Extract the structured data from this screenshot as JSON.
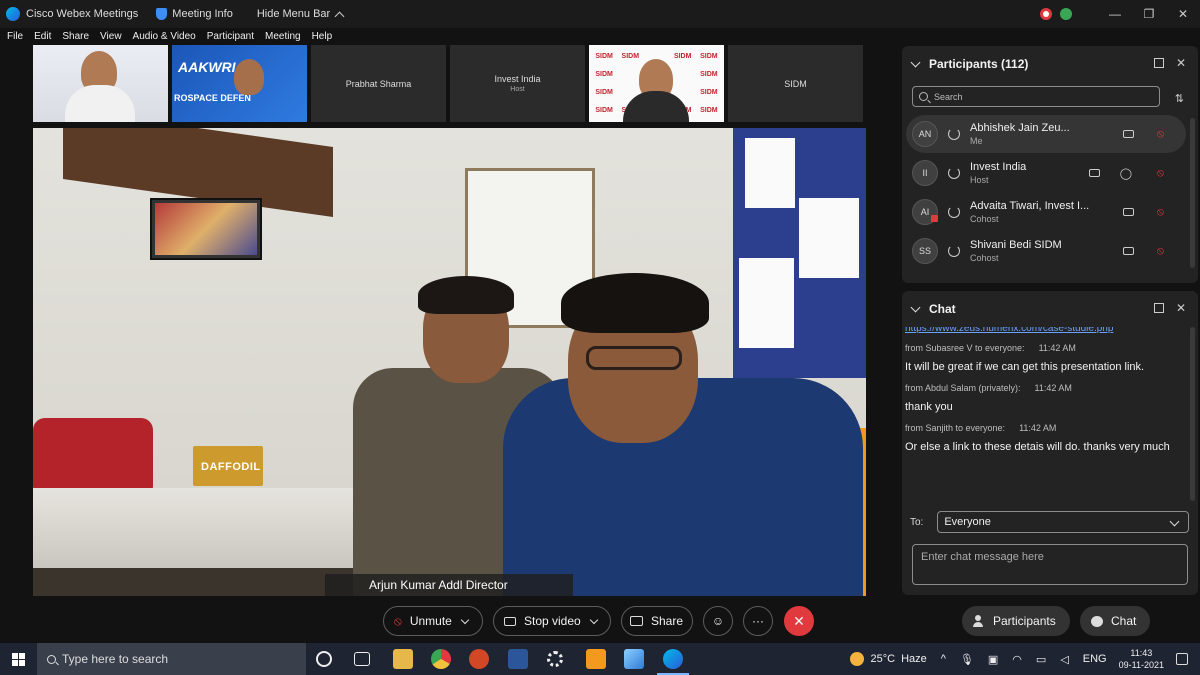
{
  "titlebar": {
    "app_title": "Cisco Webex Meetings",
    "meeting_info": "Meeting Info",
    "hide_menu": "Hide Menu Bar"
  },
  "menu": [
    "File",
    "Edit",
    "Share",
    "View",
    "Audio & Video",
    "Participant",
    "Meeting",
    "Help"
  ],
  "thumbnails": {
    "logo_text": "AAKWRI",
    "logo_sub": "ROSPACE DEFEN",
    "prabhat": "Prabhat Sharma",
    "invest": "Invest India",
    "invest_role": "Host",
    "sidm_wall": "SIDM",
    "sidm": "SIDM"
  },
  "main_video": {
    "speaker_label": "Arjun Kumar Addl Director",
    "tissue_brand": "DAFFODIL"
  },
  "participants_panel": {
    "title": "Participants (112)",
    "search_placeholder": "Search",
    "rows": [
      {
        "initials": "AN",
        "name": "Abhishek Jain Zeu...",
        "role": "Me"
      },
      {
        "initials": "II",
        "name": "Invest India",
        "role": "Host"
      },
      {
        "initials": "AI",
        "name": "Advaita Tiwari, Invest I...",
        "role": "Cohost"
      },
      {
        "initials": "SS",
        "name": "Shivani Bedi SIDM",
        "role": "Cohost"
      }
    ]
  },
  "chat_panel": {
    "title": "Chat",
    "partial_link": "https://www.zeus.numerix.com/case-studie.php",
    "messages": [
      {
        "from": "from Subasree V to everyone:",
        "time": "11:42 AM",
        "text": "It will be great if we can get this presentation link."
      },
      {
        "from": "from Abdul Salam (privately):",
        "time": "11:42 AM",
        "text": "thank you"
      },
      {
        "from": "from Sanjith to everyone:",
        "time": "11:42 AM",
        "text": "Or else a link to these detais will do. thanks very much"
      }
    ],
    "to_label": "To:",
    "to_value": "Everyone",
    "input_placeholder": "Enter chat message here"
  },
  "controls": {
    "unmute": "Unmute",
    "stop_video": "Stop video",
    "share": "Share",
    "more": "···",
    "end": "✕",
    "participants": "Participants",
    "chat": "Chat"
  },
  "taskbar": {
    "search_placeholder": "Type here to search",
    "temperature": "25°C",
    "weather": "Haze",
    "language": "ENG",
    "time": "11:43",
    "date": "09-11-2021"
  }
}
